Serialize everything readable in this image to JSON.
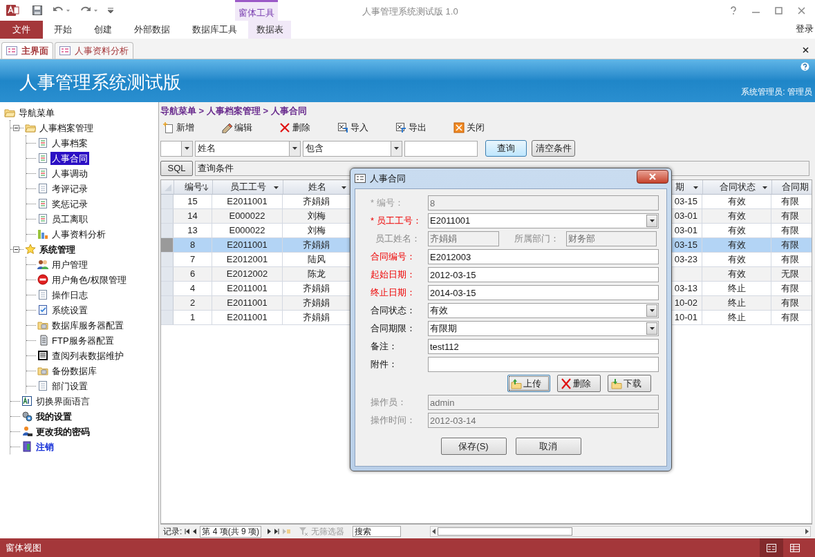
{
  "app": {
    "title": "人事管理系统测试版 1.0",
    "contextual_group": "窗体工具",
    "login": "登录"
  },
  "ribbon_tabs": [
    {
      "label": "文件",
      "kind": "file"
    },
    {
      "label": "开始",
      "kind": "normal"
    },
    {
      "label": "创建",
      "kind": "normal"
    },
    {
      "label": "外部数据",
      "kind": "normal"
    },
    {
      "label": "数据库工具",
      "kind": "normal"
    },
    {
      "label": "数据表",
      "kind": "contextual"
    }
  ],
  "document_tabs": [
    {
      "label": "主界面",
      "selected": true
    },
    {
      "label": "人事资料分析",
      "selected": false
    }
  ],
  "banner": {
    "title": "人事管理系统测试版",
    "user": "系统管理员: 管理员"
  },
  "nav_tree": {
    "label": "导航菜单",
    "kind": "folder",
    "selected": false,
    "children": [
      {
        "label": "人事档案管理",
        "kind": "folder",
        "selected": false,
        "expanded": true,
        "children": [
          {
            "label": "人事档案",
            "kind": "doc",
            "selected": false
          },
          {
            "label": "人事合同",
            "kind": "doc",
            "selected": true
          },
          {
            "label": "人事调动",
            "kind": "doc",
            "selected": false
          },
          {
            "label": "考评记录",
            "kind": "page",
            "selected": false
          },
          {
            "label": "奖惩记录",
            "kind": "doc",
            "selected": false
          },
          {
            "label": "员工离职",
            "kind": "doc",
            "selected": false
          },
          {
            "label": "人事资料分析",
            "kind": "chart",
            "selected": false
          }
        ]
      },
      {
        "label": "系统管理",
        "kind": "star",
        "selected": false,
        "expanded": true,
        "children": [
          {
            "label": "用户管理",
            "kind": "users",
            "selected": false
          },
          {
            "label": "用户角色/权限管理",
            "kind": "forbidden",
            "selected": false
          },
          {
            "label": "操作日志",
            "kind": "page",
            "selected": false
          },
          {
            "label": "系统设置",
            "kind": "checklist",
            "selected": false
          },
          {
            "label": "数据库服务器配置",
            "kind": "database",
            "selected": false
          },
          {
            "label": "FTP服务器配置",
            "kind": "server",
            "selected": false
          },
          {
            "label": "查阅列表数据维护",
            "kind": "list",
            "selected": false
          },
          {
            "label": "备份数据库",
            "kind": "database",
            "selected": false
          },
          {
            "label": "部门设置",
            "kind": "page",
            "selected": false
          }
        ]
      },
      {
        "label": "切换界面语言",
        "kind": "language",
        "selected": false
      },
      {
        "label": "我的设置",
        "kind": "gears",
        "selected": false
      },
      {
        "label": "更改我的密码",
        "kind": "user",
        "selected": false
      },
      {
        "label": "注销",
        "kind": "door",
        "selected": false
      }
    ]
  },
  "breadcrumb": "导航菜单 > 人事档案管理 > 人事合同",
  "toolbar": [
    {
      "label": "新增",
      "kind": "add"
    },
    {
      "label": "编辑",
      "kind": "edit"
    },
    {
      "label": "删除",
      "kind": "delete"
    },
    {
      "label": "导入",
      "kind": "import"
    },
    {
      "label": "导出",
      "kind": "export"
    },
    {
      "label": "关闭",
      "kind": "close"
    }
  ],
  "filter": {
    "field": "姓名",
    "operator": "包含",
    "search_button": "查询",
    "clear_button": "清空条件",
    "sql_button": "SQL",
    "condition": "查询条件"
  },
  "table": {
    "columns": [
      {
        "label": "编号",
        "sorted": true
      },
      {
        "label": "员工工号",
        "sorted": false
      },
      {
        "label": "姓名",
        "sorted": false
      },
      {
        "label": "期",
        "sorted": false
      },
      {
        "label": "合同状态",
        "sorted": false
      },
      {
        "label": "合同期",
        "sorted": false
      }
    ],
    "rows": [
      {
        "cells": [
          "15",
          "E2011001",
          "齐娟娟",
          "03-15",
          "有效",
          "有限"
        ],
        "selected": false
      },
      {
        "cells": [
          "14",
          "E000022",
          "刘梅",
          "03-01",
          "有效",
          "有限"
        ],
        "selected": false
      },
      {
        "cells": [
          "13",
          "E000022",
          "刘梅",
          "03-01",
          "有效",
          "有限"
        ],
        "selected": false
      },
      {
        "cells": [
          "8",
          "E2011001",
          "齐娟娟",
          "03-15",
          "有效",
          "有限"
        ],
        "selected": true
      },
      {
        "cells": [
          "7",
          "E2012001",
          "陆风",
          "03-23",
          "有效",
          "有限"
        ],
        "selected": false
      },
      {
        "cells": [
          "6",
          "E2012002",
          "陈龙",
          null,
          "有效",
          "无限"
        ],
        "selected": false
      },
      {
        "cells": [
          "4",
          "E2011001",
          "齐娟娟",
          "03-13",
          "终止",
          "有限"
        ],
        "selected": false
      },
      {
        "cells": [
          "2",
          "E2011001",
          "齐娟娟",
          "10-02",
          "终止",
          "有限"
        ],
        "selected": false
      },
      {
        "cells": [
          "1",
          "E2011001",
          "齐娟娟",
          "10-01",
          "终止",
          "有限"
        ],
        "selected": false
      }
    ]
  },
  "record_nav": {
    "label": "记录:",
    "position": "第 4 项(共 9 项)",
    "filter": "无筛选器",
    "search_placeholder": "搜索"
  },
  "dialog": {
    "title": "人事合同",
    "rows": [
      {
        "fields": [
          {
            "label": "* 编号：",
            "value": "8",
            "kind": "text",
            "required": true,
            "disabled": true
          }
        ]
      },
      {
        "fields": [
          {
            "label": "* 员工工号：",
            "value": "E2011001",
            "kind": "combo",
            "required": true,
            "disabled": false
          }
        ]
      },
      {
        "fields": [
          {
            "label": "员工姓名：",
            "value": "齐娟娟",
            "kind": "text",
            "required": false,
            "disabled": true
          },
          {
            "label": "所属部门：",
            "value": "财务部",
            "kind": "text",
            "required": false,
            "disabled": true
          }
        ]
      },
      {
        "fields": [
          {
            "label": "合同编号：",
            "value": "E2012003",
            "kind": "text",
            "required": true,
            "disabled": false
          }
        ]
      },
      {
        "fields": [
          {
            "label": "起始日期：",
            "value": "2012-03-15",
            "kind": "text",
            "required": true,
            "disabled": false
          }
        ]
      },
      {
        "fields": [
          {
            "label": "终止日期：",
            "value": "2014-03-15",
            "kind": "text",
            "required": true,
            "disabled": false
          }
        ]
      },
      {
        "fields": [
          {
            "label": "合同状态：",
            "value": "有效",
            "kind": "combo",
            "required": false,
            "disabled": false
          }
        ]
      },
      {
        "fields": [
          {
            "label": "合同期限：",
            "value": "有限期",
            "kind": "combo",
            "required": false,
            "disabled": false
          }
        ]
      },
      {
        "fields": [
          {
            "label": "备注：",
            "value": "test112",
            "kind": "text",
            "required": false,
            "disabled": false
          }
        ]
      },
      {
        "fields": [
          {
            "label": "附件：",
            "kind": "text",
            "required": false,
            "disabled": false
          }
        ]
      },
      {
        "kind": "buttons",
        "buttons": [
          {
            "label": "上传",
            "kind": "upload",
            "focused": true
          },
          {
            "label": "删除",
            "kind": "delete",
            "focused": false
          },
          {
            "label": "下载",
            "kind": "download",
            "focused": false
          }
        ]
      },
      {
        "fields": [
          {
            "label": "操作员：",
            "value": "admin",
            "kind": "text",
            "required": false,
            "disabled": true
          }
        ]
      },
      {
        "fields": [
          {
            "label": "操作时间：",
            "value": "2012-03-14",
            "kind": "text",
            "required": false,
            "disabled": true
          }
        ]
      }
    ],
    "footer_buttons": [
      "保存(S)",
      "取消"
    ]
  },
  "status_bar": {
    "text": "窗体视图",
    "views": [
      {
        "kind": "form",
        "selected": true
      },
      {
        "kind": "datasheet",
        "selected": false
      }
    ]
  }
}
